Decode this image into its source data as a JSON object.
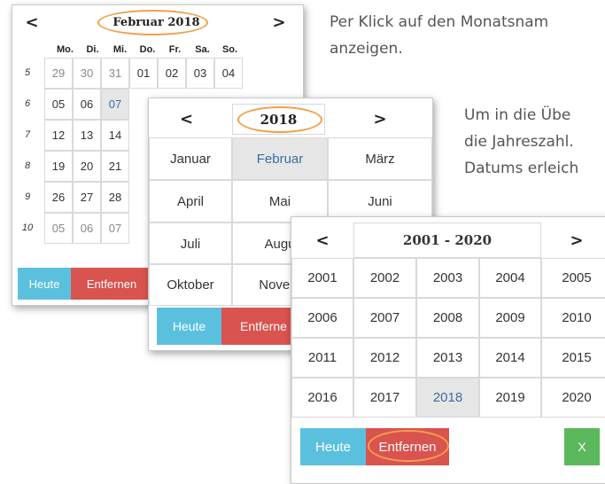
{
  "doc": {
    "line1": "Per Klick auf den Monatsnam",
    "line2": "anzeigen.",
    "line3": "Um in die Übe",
    "line4": "die Jahreszahl.",
    "line5": "Datums erleich"
  },
  "day_picker": {
    "prev": "<",
    "next": ">",
    "title": "Februar 2018",
    "weekdays": [
      "Mo.",
      "Di.",
      "Mi.",
      "Do.",
      "Fr.",
      "Sa.",
      "So."
    ],
    "weeks": [
      {
        "num": "5",
        "days": [
          "29",
          "30",
          "31",
          "01",
          "02",
          "03",
          "04"
        ]
      },
      {
        "num": "6",
        "days": [
          "05",
          "06",
          "07",
          "",
          "",
          "",
          ""
        ]
      },
      {
        "num": "7",
        "days": [
          "12",
          "13",
          "14",
          "",
          "",
          "",
          ""
        ]
      },
      {
        "num": "8",
        "days": [
          "19",
          "20",
          "21",
          "",
          "",
          "",
          ""
        ]
      },
      {
        "num": "9",
        "days": [
          "26",
          "27",
          "28",
          "",
          "",
          "",
          ""
        ]
      },
      {
        "num": "10",
        "days": [
          "05",
          "06",
          "07",
          "",
          "",
          "",
          ""
        ]
      }
    ],
    "today_label": "Heute",
    "clear_label": "Entfernen"
  },
  "month_picker": {
    "prev": "<",
    "next": ">",
    "title": "2018",
    "months": [
      "Januar",
      "Februar",
      "März",
      "April",
      "Mai",
      "Juni",
      "Juli",
      "Augu",
      "",
      "Oktober",
      "Novem",
      ""
    ],
    "today_label": "Heute",
    "clear_label": "Entferne"
  },
  "year_picker": {
    "prev": "<",
    "next": ">",
    "title": "2001 - 2020",
    "years": [
      "2001",
      "2002",
      "2003",
      "2004",
      "2005",
      "2006",
      "2007",
      "2008",
      "2009",
      "2010",
      "2011",
      "2012",
      "2013",
      "2014",
      "2015",
      "2016",
      "2017",
      "2018",
      "2019",
      "2020"
    ],
    "today_label": "Heute",
    "clear_label": "Entfernen",
    "close_label": "X"
  }
}
